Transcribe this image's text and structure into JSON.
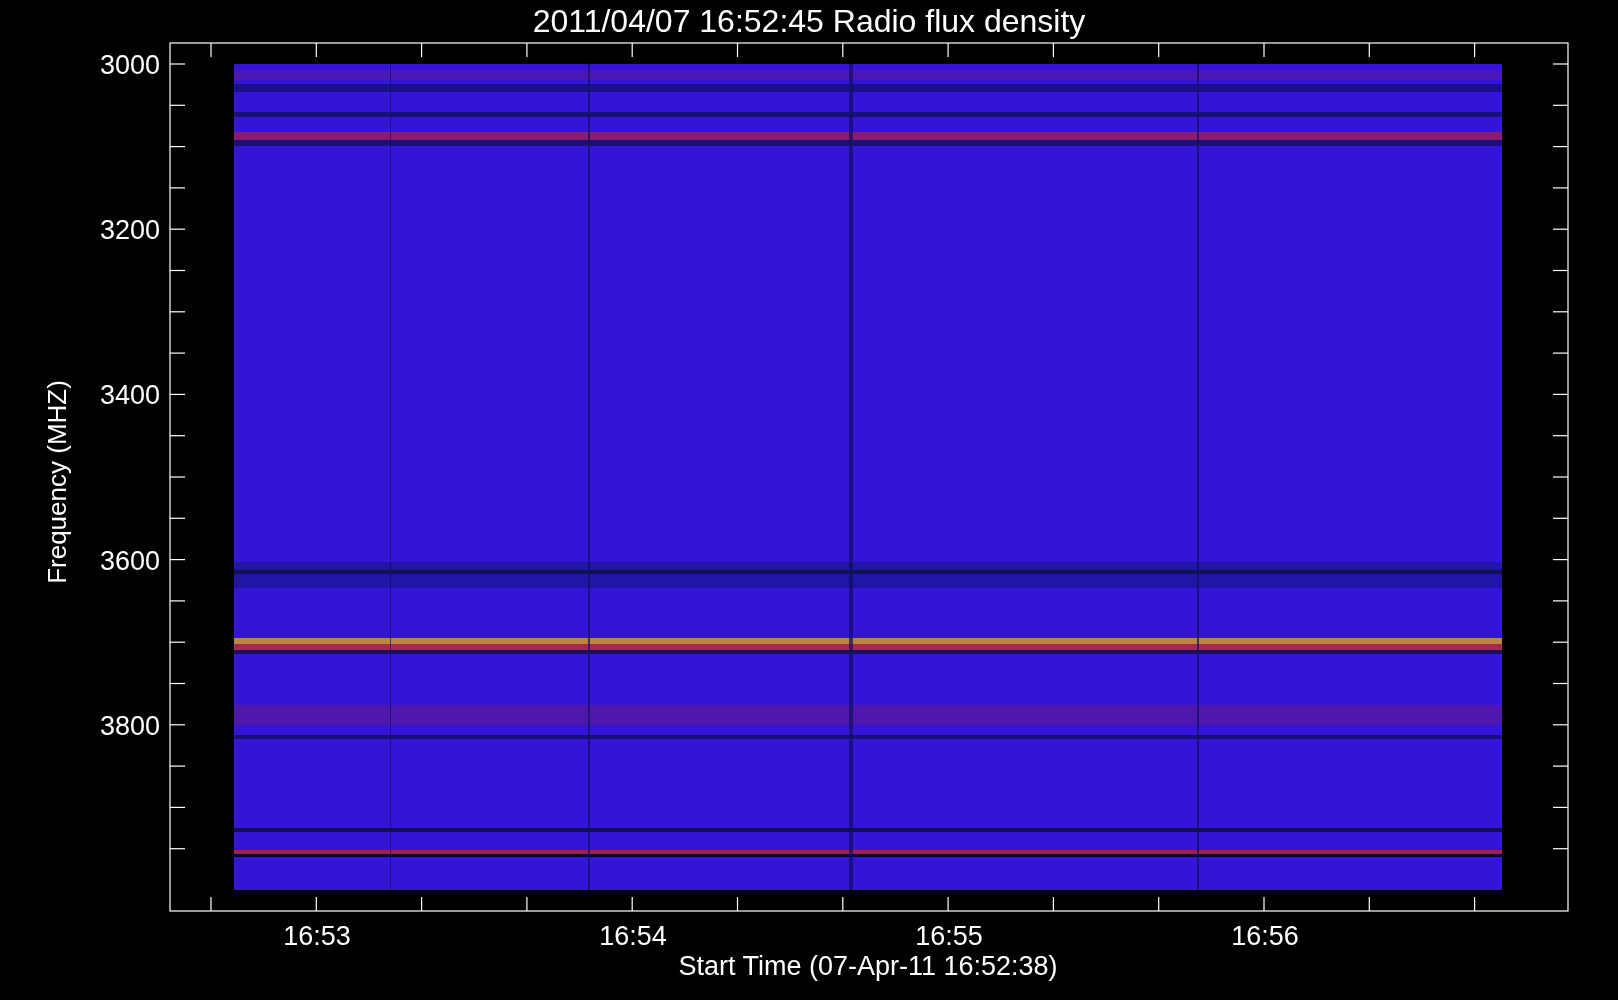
{
  "plot": {
    "title": "2011/04/07 16:52:45 Radio flux density",
    "ylabel": "Frequency (MHZ)",
    "xlabel": "Start Time (07-Apr-11 16:52:38)",
    "yticks": [
      "3000",
      "3200",
      "3400",
      "3600",
      "3800"
    ],
    "xticks": [
      "16:53",
      "16:54",
      "16:55",
      "16:56"
    ]
  }
}
